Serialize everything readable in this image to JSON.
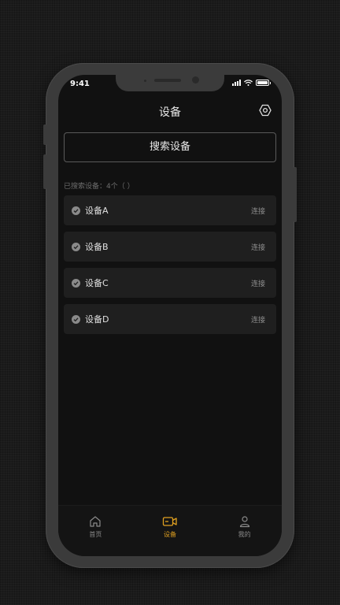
{
  "status_bar": {
    "time": "9:41"
  },
  "header": {
    "title": "设备",
    "settings_icon": "settings-hexagon-icon"
  },
  "search": {
    "button_label": "搜索设备"
  },
  "found_label": "已搜索设备：4个（ ）",
  "devices": [
    {
      "name": "设备A",
      "action": "连接"
    },
    {
      "name": "设备B",
      "action": "连接"
    },
    {
      "name": "设备C",
      "action": "连接"
    },
    {
      "name": "设备D",
      "action": "连接"
    }
  ],
  "tabbar": {
    "items": [
      {
        "label": "首页",
        "icon": "home-icon",
        "active": false
      },
      {
        "label": "设备",
        "icon": "camera-icon",
        "active": true
      },
      {
        "label": "我的",
        "icon": "user-icon",
        "active": false
      }
    ]
  },
  "colors": {
    "accent": "#e0a020",
    "background": "#111111",
    "card": "#1f1f1f"
  }
}
